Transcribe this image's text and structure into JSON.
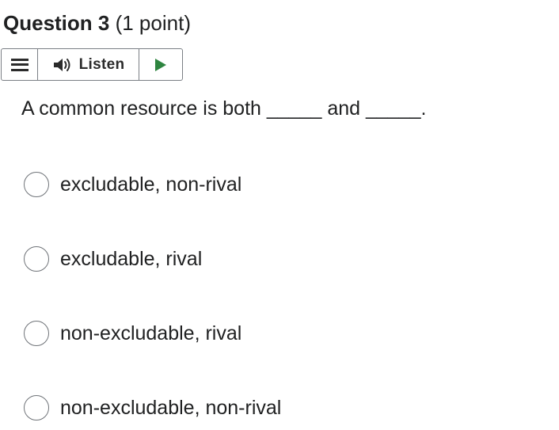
{
  "question": {
    "title": "Question 3",
    "points": "(1 point)",
    "prompt": "A common resource is both _____ and _____."
  },
  "toolbar": {
    "menu_icon": "hamburger-menu-icon",
    "speaker_icon": "speaker-icon",
    "listen_label": "Listen",
    "play_icon": "play-icon",
    "play_color": "#2e8540"
  },
  "options": [
    {
      "label": "excludable, non-rival",
      "selected": false
    },
    {
      "label": "excludable, rival",
      "selected": false
    },
    {
      "label": "non-excludable, rival",
      "selected": false
    },
    {
      "label": "non-excludable, non-rival",
      "selected": false
    }
  ]
}
